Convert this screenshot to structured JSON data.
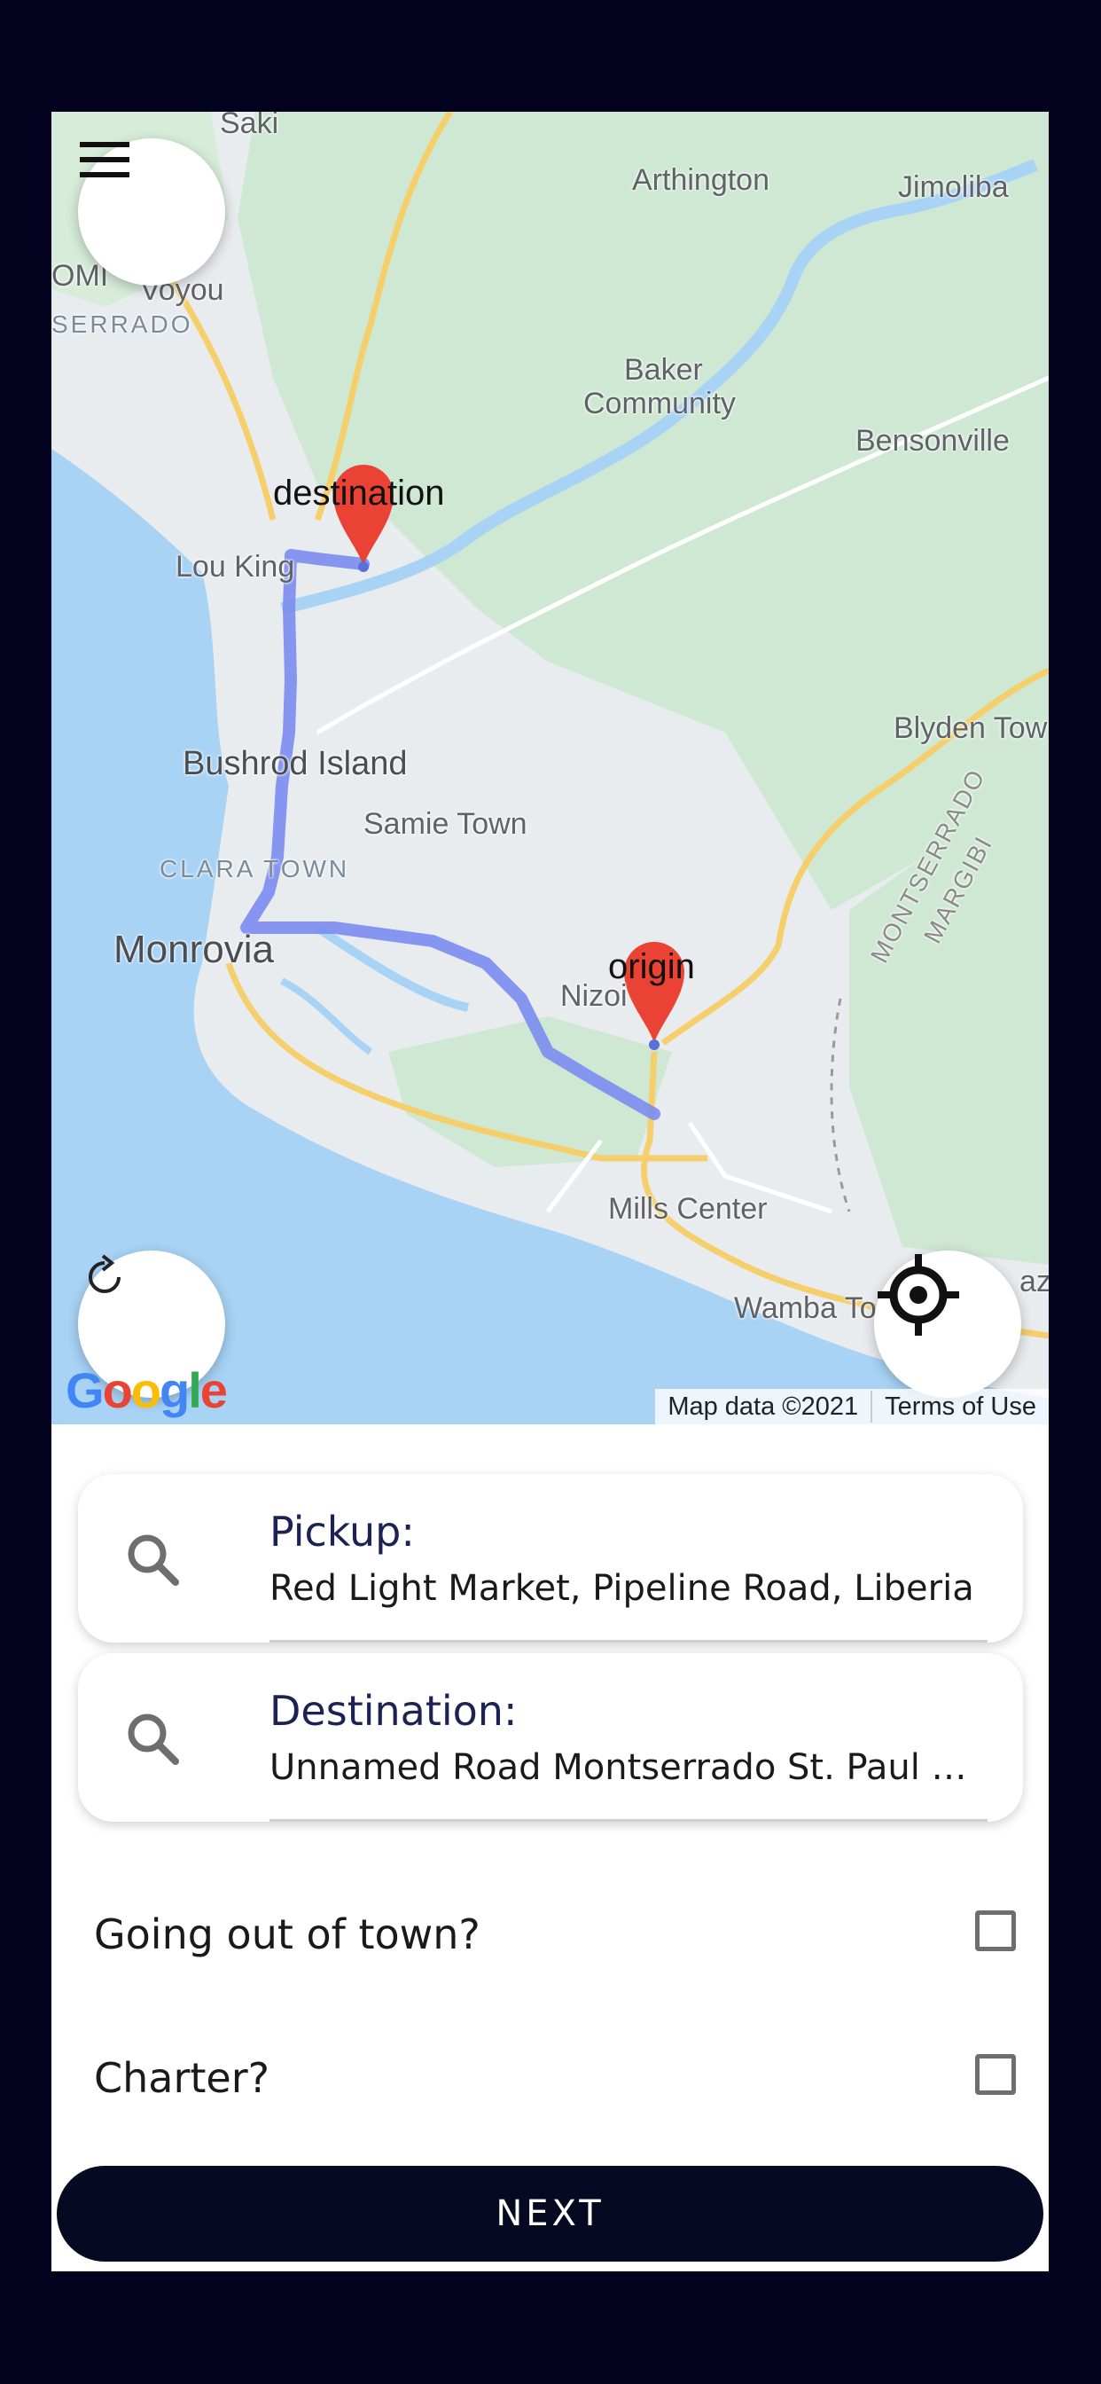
{
  "map": {
    "labels": {
      "saki": "Saki",
      "arthington": "Arthington",
      "jimoliba": "Jimoliba",
      "omi": "OMI",
      "voyou": "Voyou",
      "serrado": "SERRADO",
      "baker": "Baker",
      "community": "Community",
      "bensonville": "Bensonville",
      "lou_king": "Lou King",
      "bushrod_island": "Bushrod Island",
      "samie_town": "Samie Town",
      "clara_town": "CLARA TOWN",
      "monrovia": "Monrovia",
      "nizoi": "Nizoi",
      "blyden_town": "Blyden Tow",
      "montserrado": "MONTSERRADO",
      "margibi": "MARGIBI",
      "mills_center": "Mills Center",
      "wamba": "Wamba To",
      "az": "az"
    },
    "markers": {
      "destination": "destination",
      "origin": "origin"
    },
    "attribution": {
      "map_data": "Map data ©2021",
      "terms": "Terms of Use"
    },
    "google_logo": "Google",
    "colors": {
      "water": "#a8d3f5",
      "land": "#e9ecef",
      "green": "#cfe8d3",
      "route": "#7a8cf0",
      "marker": "#ea4335",
      "road": "#f5cf6b"
    }
  },
  "buttons": {
    "menu_icon": "menu-icon",
    "refresh_icon": "refresh-icon",
    "locate_icon": "crosshair-icon",
    "next": "NEXT"
  },
  "pickup": {
    "label": "Pickup:",
    "value": "Red Light Market, Pipeline Road, Liberia"
  },
  "destination": {
    "label": "Destination:",
    "value": "Unnamed Road Montserrado St. Paul Ri..."
  },
  "options": {
    "out_of_town": "Going out of town?",
    "charter": "Charter?"
  }
}
